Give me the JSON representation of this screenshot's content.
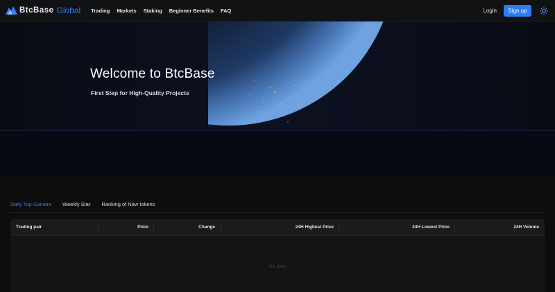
{
  "header": {
    "brand": "BtcBase",
    "brand_suffix": "Global",
    "nav": [
      "Trading",
      "Markets",
      "Staking",
      "Beginner Benefits",
      "FAQ"
    ],
    "login_label": "Login",
    "signup_label": "Sign up",
    "accent_color": "#2e7cf6"
  },
  "hero": {
    "title": "Welcome to BtcBase",
    "subtitle": "First Step for High-Quality Projects"
  },
  "tabs": [
    "Daily Top Gainers",
    "Weekly Star",
    "Ranking of New tokens"
  ],
  "active_tab": "Daily Top Gainers",
  "table": {
    "columns": [
      "Trading pair",
      "Price",
      "Change",
      "24H Highest Price",
      "24H Lowest Price",
      "24H Volume"
    ],
    "empty_text": "No data"
  }
}
